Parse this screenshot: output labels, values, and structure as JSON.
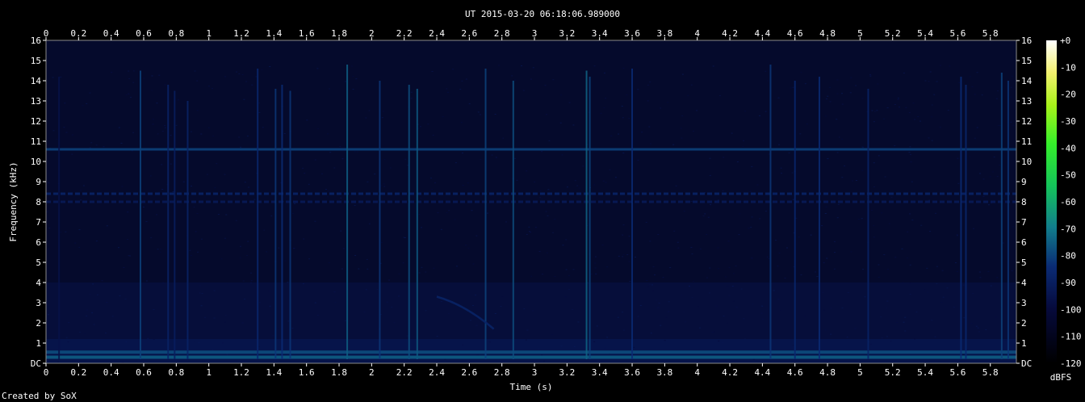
{
  "chart_data": {
    "type": "heatmap",
    "title": "UT 2015-03-20 06:18:06.989000",
    "xlabel": "Time (s)",
    "ylabel": "Frequency (kHz)",
    "xlim": [
      0,
      5.96
    ],
    "ylim": [
      0,
      16
    ],
    "x_ticks": [
      "0",
      "0.2",
      "0.4",
      "0.6",
      "0.8",
      "1",
      "1.2",
      "1.4",
      "1.6",
      "1.8",
      "2",
      "2.2",
      "2.4",
      "2.6",
      "2.8",
      "3",
      "3.2",
      "3.4",
      "3.6",
      "3.8",
      "4",
      "4.2",
      "4.4",
      "4.6",
      "4.8",
      "5",
      "5.2",
      "5.4",
      "5.6",
      "5.8"
    ],
    "y_ticks": [
      "DC",
      "1",
      "2",
      "3",
      "4",
      "5",
      "6",
      "7",
      "8",
      "9",
      "10",
      "11",
      "12",
      "13",
      "14",
      "15",
      "16"
    ],
    "colorbar": {
      "label": "dBFS",
      "ticks": [
        "+0",
        "-10",
        "-20",
        "-30",
        "-40",
        "-50",
        "-60",
        "-70",
        "-80",
        "-90",
        "-100",
        "-110",
        "-120"
      ],
      "range": [
        -120,
        0
      ]
    },
    "background_level_dbfs": -100,
    "tones": [
      {
        "freq_khz": 10.6,
        "level_dbfs": -80
      },
      {
        "freq_khz": 8.4,
        "level_dbfs": -88
      },
      {
        "freq_khz": 8.0,
        "level_dbfs": -92
      },
      {
        "freq_khz": 0.55,
        "level_dbfs": -78
      },
      {
        "freq_khz": 0.3,
        "level_dbfs": -75
      }
    ],
    "impulses": [
      {
        "t": 0.08,
        "top_khz": 14.2,
        "level_dbfs": -96
      },
      {
        "t": 0.58,
        "top_khz": 14.5,
        "level_dbfs": -80
      },
      {
        "t": 0.75,
        "top_khz": 13.8,
        "level_dbfs": -88
      },
      {
        "t": 0.79,
        "top_khz": 13.5,
        "level_dbfs": -90
      },
      {
        "t": 0.87,
        "top_khz": 13.0,
        "level_dbfs": -88
      },
      {
        "t": 1.3,
        "top_khz": 14.6,
        "level_dbfs": -86
      },
      {
        "t": 1.41,
        "top_khz": 13.6,
        "level_dbfs": -82
      },
      {
        "t": 1.45,
        "top_khz": 13.8,
        "level_dbfs": -84
      },
      {
        "t": 1.5,
        "top_khz": 13.5,
        "level_dbfs": -82
      },
      {
        "t": 1.85,
        "top_khz": 14.8,
        "level_dbfs": -75
      },
      {
        "t": 2.05,
        "top_khz": 14.0,
        "level_dbfs": -82
      },
      {
        "t": 2.23,
        "top_khz": 13.8,
        "level_dbfs": -78
      },
      {
        "t": 2.28,
        "top_khz": 13.6,
        "level_dbfs": -76
      },
      {
        "t": 2.7,
        "top_khz": 14.6,
        "level_dbfs": -80
      },
      {
        "t": 2.87,
        "top_khz": 14.0,
        "level_dbfs": -78
      },
      {
        "t": 3.32,
        "top_khz": 14.5,
        "level_dbfs": -74
      },
      {
        "t": 3.34,
        "top_khz": 14.2,
        "level_dbfs": -80
      },
      {
        "t": 3.6,
        "top_khz": 14.6,
        "level_dbfs": -84
      },
      {
        "t": 4.45,
        "top_khz": 14.8,
        "level_dbfs": -82
      },
      {
        "t": 4.6,
        "top_khz": 14.0,
        "level_dbfs": -86
      },
      {
        "t": 4.75,
        "top_khz": 14.2,
        "level_dbfs": -84
      },
      {
        "t": 5.05,
        "top_khz": 13.6,
        "level_dbfs": -88
      },
      {
        "t": 5.62,
        "top_khz": 14.2,
        "level_dbfs": -84
      },
      {
        "t": 5.65,
        "top_khz": 13.8,
        "level_dbfs": -86
      },
      {
        "t": 5.87,
        "top_khz": 14.4,
        "level_dbfs": -80
      },
      {
        "t": 5.91,
        "top_khz": 14.0,
        "level_dbfs": -82
      }
    ],
    "sweep": {
      "t_start": 2.4,
      "t_end": 2.75,
      "f_start_khz": 3.3,
      "f_end_khz": 1.7,
      "level_dbfs": -88
    }
  },
  "footer": {
    "credit": "Created by SoX"
  }
}
